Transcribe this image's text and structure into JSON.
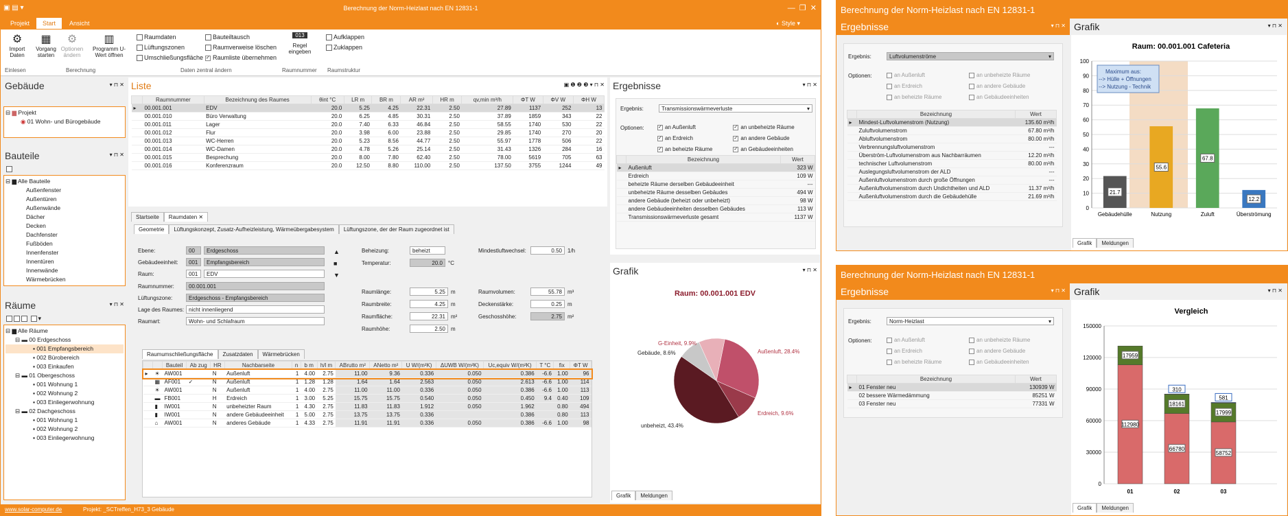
{
  "app": {
    "title": "Berechnung der Norm-Heizlast nach EN 12831-1",
    "style_label": "Style",
    "ribbon_tabs": [
      "Projekt",
      "Start",
      "Ansicht"
    ]
  },
  "ribbon": {
    "einlesen": {
      "import": "Import Daten",
      "group": "Einlesen"
    },
    "berechnung": {
      "vorgang": "Vorgang starten",
      "optionen": "Optionen ändern",
      "programm": "Programm U-Wert öffnen",
      "group": "Berechnung"
    },
    "daten": {
      "items": [
        "Raumdaten",
        "Lüftungszonen",
        "Umschließungsfläche",
        "Bauteiltausch",
        "Raumverweise löschen",
        "Raumliste übernehmen"
      ],
      "group": "Daten zentral ändern"
    },
    "raumnummer": {
      "regel": "Regel eingeben",
      "group": "Raumnummer",
      "icon_text": "013"
    },
    "raumstruktur": {
      "auf": "Aufklappen",
      "zu": "Zuklappen",
      "group": "Raumstruktur"
    }
  },
  "gebaeude": {
    "title": "Gebäude",
    "tree": [
      "Projekt",
      "01 Wohn- und Bürogebäude"
    ]
  },
  "bauteile": {
    "title": "Bauteile",
    "tree": [
      "Alle Bauteile",
      "Außenfenster",
      "Außentüren",
      "Außenwände",
      "Dächer",
      "Decken",
      "Dachfenster",
      "Fußböden",
      "Innenfenster",
      "Innentüren",
      "Innenwände",
      "Wärmebrücken"
    ]
  },
  "raeume": {
    "title": "Räume",
    "tree": [
      "Alle Räume",
      "00 Erdgeschoss",
      "001 Empfangsbereich",
      "002 Bürobereich",
      "003 Einkaufen",
      "01 Obergeschoss",
      "001 Wohnung 1",
      "002 Wohnung 2",
      "003 Einliegerwohnung",
      "02 Dachgeschoss",
      "001 Wohnung 1",
      "002 Wohnung 2",
      "003 Einliegerwohnung"
    ]
  },
  "liste": {
    "title": "Liste",
    "headers": [
      "Raumnummer",
      "Bezeichnung des Raumes",
      "θint °C",
      "LR m",
      "BR m",
      "AR m²",
      "HR m",
      "qv,min m³/h",
      "ΦT W",
      "ΦV W",
      "ΦH W"
    ],
    "rows": [
      [
        "00.001.001",
        "EDV",
        "20.0",
        "5.25",
        "4.25",
        "22.31",
        "2.50",
        "27.89",
        "1137",
        "252",
        "13"
      ],
      [
        "00.001.010",
        "Büro Verwaltung",
        "20.0",
        "6.25",
        "4.85",
        "30.31",
        "2.50",
        "37.89",
        "1859",
        "343",
        "22"
      ],
      [
        "00.001.011",
        "Lager",
        "20.0",
        "7.40",
        "6.33",
        "46.84",
        "2.50",
        "58.55",
        "1740",
        "530",
        "22"
      ],
      [
        "00.001.012",
        "Flur",
        "20.0",
        "3.98",
        "6.00",
        "23.88",
        "2.50",
        "29.85",
        "1740",
        "270",
        "20"
      ],
      [
        "00.001.013",
        "WC-Herren",
        "20.0",
        "5.23",
        "8.56",
        "44.77",
        "2.50",
        "55.97",
        "1778",
        "506",
        "22"
      ],
      [
        "00.001.014",
        "WC-Damen",
        "20.0",
        "4.78",
        "5.26",
        "25.14",
        "2.50",
        "31.43",
        "1326",
        "284",
        "16"
      ],
      [
        "00.001.015",
        "Besprechung",
        "20.0",
        "8.00",
        "7.80",
        "62.40",
        "2.50",
        "78.00",
        "5619",
        "705",
        "63"
      ],
      [
        "00.001.016",
        "Konferenzraum",
        "20.0",
        "12.50",
        "8.80",
        "110.00",
        "2.50",
        "137.50",
        "3755",
        "1244",
        "49"
      ]
    ]
  },
  "detail": {
    "tabs": [
      "Startseite",
      "Raumdaten"
    ],
    "subtabs": [
      "Geometrie",
      "Lüftungskonzept, Zusatz-Aufheizleistung, Wärmeübergabesystem",
      "Lüftungszone, der der Raum zugeordnet ist"
    ],
    "ebene": {
      "label": "Ebene:",
      "code": "00",
      "name": "Erdgeschoss"
    },
    "einheit": {
      "label": "Gebäudeeinheit:",
      "code": "001",
      "name": "Empfangsbereich"
    },
    "raum": {
      "label": "Raum:",
      "code": "001",
      "name": "EDV"
    },
    "raumnummer": {
      "label": "Raumnummer:",
      "value": "00.001.001"
    },
    "lzone": {
      "label": "Lüftungszone:",
      "value": "Erdgeschoss - Empfangsbereich"
    },
    "lage": {
      "label": "Lage des Raumes:",
      "value": "nicht innenliegend"
    },
    "raumart": {
      "label": "Raumart:",
      "value": "Wohn- und Schlafraum"
    },
    "beheizung": {
      "label": "Beheizung:",
      "value": "beheizt"
    },
    "temperatur": {
      "label": "Temperatur:",
      "value": "20.0",
      "unit": "°C"
    },
    "mlw": {
      "label": "Mindestluftwechsel:",
      "value": "0.50",
      "unit": "1/h"
    },
    "laenge": {
      "label": "Raumlänge:",
      "value": "5.25",
      "unit": "m"
    },
    "breite": {
      "label": "Raumbreite:",
      "value": "4.25",
      "unit": "m"
    },
    "flaeche": {
      "label": "Raumfläche:",
      "value": "22.31",
      "unit": "m²"
    },
    "hoehe": {
      "label": "Raumhöhe:",
      "value": "2.50",
      "unit": "m"
    },
    "volumen": {
      "label": "Raumvolumen:",
      "value": "55.78",
      "unit": "m³"
    },
    "decke": {
      "label": "Deckenstärke:",
      "value": "0.25",
      "unit": "m"
    },
    "gh": {
      "label": "Geschosshöhe:",
      "value": "2.75",
      "unit": "m²"
    },
    "btabs": [
      "Raumumschließungsfläche",
      "Zusatzdaten",
      "Wärmebrücken"
    ],
    "bheaders": [
      "Bauteil",
      "Ab zug",
      "HR",
      "Nachbarseite",
      "n",
      "b m",
      "h/l m",
      "ABrutto m²",
      "ANetto m²",
      "U W/(m²K)",
      "ΔUWB W/(m²K)",
      "Uc,equiv W/(m²K)",
      "T °C",
      "fix",
      "ΦT W"
    ],
    "brows": [
      [
        "AW001",
        "",
        "N",
        "Außenluft",
        "1",
        "4.00",
        "2.75",
        "11.00",
        "9.36",
        "0.336",
        "0.050",
        "0.386",
        "-6.6",
        "1.00",
        "96"
      ],
      [
        "AF001",
        "✓",
        "N",
        "Außenluft",
        "1",
        "1.28",
        "1.28",
        "1.64",
        "1.64",
        "2.563",
        "0.050",
        "2.613",
        "-6.6",
        "1.00",
        "114"
      ],
      [
        "AW001",
        "",
        "N",
        "Außenluft",
        "1",
        "4.00",
        "2.75",
        "11.00",
        "11.00",
        "0.336",
        "0.050",
        "0.386",
        "-6.6",
        "1.00",
        "113"
      ],
      [
        "FB001",
        "",
        "H",
        "Erdreich",
        "1",
        "3.00",
        "5.25",
        "15.75",
        "15.75",
        "0.540",
        "0.050",
        "0.450",
        "9.4",
        "0.40",
        "109"
      ],
      [
        "IW001",
        "",
        "N",
        "unbeheizter Raum",
        "1",
        "4.30",
        "2.75",
        "11.83",
        "11.83",
        "1.912",
        "0.050",
        "1.962",
        "",
        "0.80",
        "494"
      ],
      [
        "IW001",
        "",
        "N",
        "andere Gebäudeeinheit",
        "1",
        "5.00",
        "2.75",
        "13.75",
        "13.75",
        "0.336",
        "",
        "0.386",
        "",
        "0.80",
        "113"
      ],
      [
        "AW001",
        "",
        "N",
        "anderes Gebäude",
        "1",
        "4.33",
        "2.75",
        "11.91",
        "11.91",
        "0.336",
        "0.050",
        "0.386",
        "-6.6",
        "1.00",
        "98"
      ]
    ]
  },
  "ergebnisse": {
    "title": "Ergebnisse",
    "ergebnis_label": "Ergebnis:",
    "ergebnis_value": "Transmissionswärmeverluste",
    "optionen_label": "Optionen:",
    "opts": [
      "an Außenluft",
      "an unbeheizte Räume",
      "an Erdreich",
      "an andere Gebäude",
      "an beheizte Räume",
      "an Gebäudeeinheiten"
    ],
    "col1": "Bezeichnung",
    "col2": "Wert",
    "rows": [
      [
        "Außenluft",
        "323 W"
      ],
      [
        "Erdreich",
        "109 W"
      ],
      [
        "beheizte Räume derselben Gebäudeeinheit",
        "---"
      ],
      [
        "unbeheizte Räume desselben Gebäudes",
        "494 W"
      ],
      [
        "andere Gebäude (beheizt oder unbeheizt)",
        "98 W"
      ],
      [
        "andere Gebäudeeinheiten desselben Gebäudes",
        "113 W"
      ],
      [
        "Transmissionswärmeverluste gesamt",
        "1137 W"
      ]
    ]
  },
  "grafik": {
    "title": "Grafik",
    "chart_title": "Raum: 00.001.001 EDV",
    "tabs": [
      "Grafik",
      "Meldungen"
    ]
  },
  "chart_data": [
    {
      "type": "pie",
      "title": "Raum: 00.001.001 EDV",
      "slices": [
        {
          "label": "Außenluft, 28.4%",
          "value": 28.4,
          "color": "#c0506a"
        },
        {
          "label": "Erdreich, 9.6%",
          "value": 9.6,
          "color": "#9a3a4a"
        },
        {
          "label": "unbeheizt, 43.4%",
          "value": 43.4,
          "color": "#5a1a22"
        },
        {
          "label": "Gebäude, 8.6%",
          "value": 8.6,
          "color": "#c8c8c8"
        },
        {
          "label": "G-Einheit, 9.9%",
          "value": 9.9,
          "color": "#e8b0b8"
        }
      ]
    },
    {
      "type": "bar",
      "title": "Raum: 00.001.001 Cafeteria",
      "categories": [
        "Gebäudehülle",
        "Nutzung",
        "Zuluft",
        "Überströmung"
      ],
      "values": [
        21.7,
        55.6,
        67.8,
        12.2
      ],
      "ylim": [
        0,
        100
      ],
      "yticks": [
        0,
        10,
        20,
        30,
        40,
        50,
        60,
        70,
        80,
        90,
        100
      ],
      "colors": [
        "#555",
        "#e8a822",
        "#5aa85a",
        "#3a78c0"
      ],
      "annotation": [
        "Maximum aus:",
        "--> Hülle + Öffnungen",
        "--> Nutzung - Technik"
      ]
    },
    {
      "type": "bar",
      "title": "Vergleich",
      "categories": [
        "01",
        "02",
        "03"
      ],
      "series": [
        {
          "values": [
            112980,
            66780,
            58752
          ],
          "color": "#d96a6a"
        },
        {
          "values": [
            17959,
            18161,
            17999
          ],
          "color": "#557a2a"
        },
        {
          "values": [
            0,
            310,
            581
          ],
          "color": "#3a6cc0"
        }
      ],
      "ylim": [
        0,
        150000
      ],
      "yticks": [
        0,
        30000,
        60000,
        90000,
        120000,
        150000
      ]
    }
  ],
  "r1": {
    "window_title": "Berechnung der Norm-Heizlast nach EN 12831-1",
    "title": "Ergebnisse",
    "ergebnis_label": "Ergebnis:",
    "ergebnis_value": "Luftvolumenströme",
    "optionen_label": "Optionen:",
    "opts": [
      "an Außenluft",
      "an unbeheizte Räume",
      "an Erdreich",
      "an andere Gebäude",
      "an beheizte Räume",
      "an Gebäudeeinheiten"
    ],
    "col1": "Bezeichnung",
    "col2": "Wert",
    "rows": [
      [
        "Mindest-Luftvolumenstrom (Nutzung)",
        "135.60 m³/h"
      ],
      [
        "Zuluftvolumenstrom",
        "67.80 m³/h"
      ],
      [
        "Abluftvolumenstrom",
        "80.00 m³/h"
      ],
      [
        "Verbrennungsluftvolumenstrom",
        "---"
      ],
      [
        "Überström-Luftvolumenstrom aus Nachbarräumen",
        "12.20 m³/h"
      ],
      [
        "technischer Luftvolumenstrom",
        "80.00 m³/h"
      ],
      [
        "Auslegungsluftvolumenstrom der ALD",
        "---"
      ],
      [
        "Außenluftvolumenstrom durch große Öffnungen",
        "---"
      ],
      [
        "Außenluftvolumenstrom durch Undichtheiten und ALD",
        "11.37 m³/h"
      ],
      [
        "Außenluftvolumenstrom durch die Gebäudehülle",
        "21.69 m³/h"
      ]
    ],
    "grafik_title": "Grafik",
    "tabs": [
      "Grafik",
      "Meldungen"
    ]
  },
  "r2": {
    "window_title": "Berechnung der Norm-Heizlast nach EN 12831-1",
    "title": "Ergebnisse",
    "ergebnis_label": "Ergebnis:",
    "ergebnis_value": "Norm-Heizlast",
    "optionen_label": "Optionen:",
    "opts": [
      "an Außenluft",
      "an unbeheizte Räume",
      "an Erdreich",
      "an andere Gebäude",
      "an beheizte Räume",
      "an Gebäudeeinheiten"
    ],
    "col1": "Bezeichnung",
    "col2": "Wert",
    "rows": [
      [
        "01 Fenster neu",
        "130939 W"
      ],
      [
        "02 bessere Wärmedämmung",
        "85251 W"
      ],
      [
        "03 Fenster neu",
        "77331 W"
      ]
    ],
    "grafik_title": "Grafik",
    "tabs": [
      "Grafik",
      "Meldungen"
    ]
  },
  "status": {
    "link": "www.solar-computer.de",
    "project": "Projekt: _SCTreffen_H73_3 Gebäude"
  }
}
